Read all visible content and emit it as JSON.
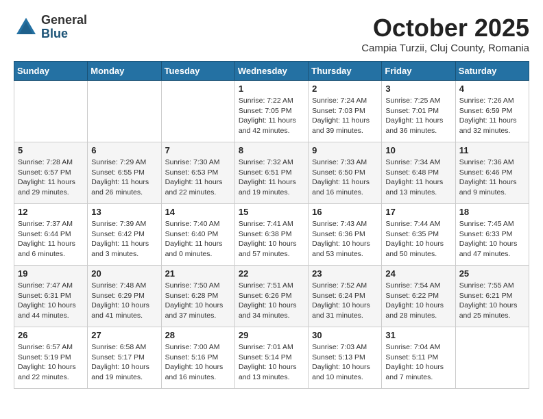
{
  "header": {
    "logo_general": "General",
    "logo_blue": "Blue",
    "month_title": "October 2025",
    "subtitle": "Campia Turzii, Cluj County, Romania"
  },
  "weekdays": [
    "Sunday",
    "Monday",
    "Tuesday",
    "Wednesday",
    "Thursday",
    "Friday",
    "Saturday"
  ],
  "weeks": [
    [
      {
        "day": "",
        "info": ""
      },
      {
        "day": "",
        "info": ""
      },
      {
        "day": "",
        "info": ""
      },
      {
        "day": "1",
        "info": "Sunrise: 7:22 AM\nSunset: 7:05 PM\nDaylight: 11 hours\nand 42 minutes."
      },
      {
        "day": "2",
        "info": "Sunrise: 7:24 AM\nSunset: 7:03 PM\nDaylight: 11 hours\nand 39 minutes."
      },
      {
        "day": "3",
        "info": "Sunrise: 7:25 AM\nSunset: 7:01 PM\nDaylight: 11 hours\nand 36 minutes."
      },
      {
        "day": "4",
        "info": "Sunrise: 7:26 AM\nSunset: 6:59 PM\nDaylight: 11 hours\nand 32 minutes."
      }
    ],
    [
      {
        "day": "5",
        "info": "Sunrise: 7:28 AM\nSunset: 6:57 PM\nDaylight: 11 hours\nand 29 minutes."
      },
      {
        "day": "6",
        "info": "Sunrise: 7:29 AM\nSunset: 6:55 PM\nDaylight: 11 hours\nand 26 minutes."
      },
      {
        "day": "7",
        "info": "Sunrise: 7:30 AM\nSunset: 6:53 PM\nDaylight: 11 hours\nand 22 minutes."
      },
      {
        "day": "8",
        "info": "Sunrise: 7:32 AM\nSunset: 6:51 PM\nDaylight: 11 hours\nand 19 minutes."
      },
      {
        "day": "9",
        "info": "Sunrise: 7:33 AM\nSunset: 6:50 PM\nDaylight: 11 hours\nand 16 minutes."
      },
      {
        "day": "10",
        "info": "Sunrise: 7:34 AM\nSunset: 6:48 PM\nDaylight: 11 hours\nand 13 minutes."
      },
      {
        "day": "11",
        "info": "Sunrise: 7:36 AM\nSunset: 6:46 PM\nDaylight: 11 hours\nand 9 minutes."
      }
    ],
    [
      {
        "day": "12",
        "info": "Sunrise: 7:37 AM\nSunset: 6:44 PM\nDaylight: 11 hours\nand 6 minutes."
      },
      {
        "day": "13",
        "info": "Sunrise: 7:39 AM\nSunset: 6:42 PM\nDaylight: 11 hours\nand 3 minutes."
      },
      {
        "day": "14",
        "info": "Sunrise: 7:40 AM\nSunset: 6:40 PM\nDaylight: 11 hours\nand 0 minutes."
      },
      {
        "day": "15",
        "info": "Sunrise: 7:41 AM\nSunset: 6:38 PM\nDaylight: 10 hours\nand 57 minutes."
      },
      {
        "day": "16",
        "info": "Sunrise: 7:43 AM\nSunset: 6:36 PM\nDaylight: 10 hours\nand 53 minutes."
      },
      {
        "day": "17",
        "info": "Sunrise: 7:44 AM\nSunset: 6:35 PM\nDaylight: 10 hours\nand 50 minutes."
      },
      {
        "day": "18",
        "info": "Sunrise: 7:45 AM\nSunset: 6:33 PM\nDaylight: 10 hours\nand 47 minutes."
      }
    ],
    [
      {
        "day": "19",
        "info": "Sunrise: 7:47 AM\nSunset: 6:31 PM\nDaylight: 10 hours\nand 44 minutes."
      },
      {
        "day": "20",
        "info": "Sunrise: 7:48 AM\nSunset: 6:29 PM\nDaylight: 10 hours\nand 41 minutes."
      },
      {
        "day": "21",
        "info": "Sunrise: 7:50 AM\nSunset: 6:28 PM\nDaylight: 10 hours\nand 37 minutes."
      },
      {
        "day": "22",
        "info": "Sunrise: 7:51 AM\nSunset: 6:26 PM\nDaylight: 10 hours\nand 34 minutes."
      },
      {
        "day": "23",
        "info": "Sunrise: 7:52 AM\nSunset: 6:24 PM\nDaylight: 10 hours\nand 31 minutes."
      },
      {
        "day": "24",
        "info": "Sunrise: 7:54 AM\nSunset: 6:22 PM\nDaylight: 10 hours\nand 28 minutes."
      },
      {
        "day": "25",
        "info": "Sunrise: 7:55 AM\nSunset: 6:21 PM\nDaylight: 10 hours\nand 25 minutes."
      }
    ],
    [
      {
        "day": "26",
        "info": "Sunrise: 6:57 AM\nSunset: 5:19 PM\nDaylight: 10 hours\nand 22 minutes."
      },
      {
        "day": "27",
        "info": "Sunrise: 6:58 AM\nSunset: 5:17 PM\nDaylight: 10 hours\nand 19 minutes."
      },
      {
        "day": "28",
        "info": "Sunrise: 7:00 AM\nSunset: 5:16 PM\nDaylight: 10 hours\nand 16 minutes."
      },
      {
        "day": "29",
        "info": "Sunrise: 7:01 AM\nSunset: 5:14 PM\nDaylight: 10 hours\nand 13 minutes."
      },
      {
        "day": "30",
        "info": "Sunrise: 7:03 AM\nSunset: 5:13 PM\nDaylight: 10 hours\nand 10 minutes."
      },
      {
        "day": "31",
        "info": "Sunrise: 7:04 AM\nSunset: 5:11 PM\nDaylight: 10 hours\nand 7 minutes."
      },
      {
        "day": "",
        "info": ""
      }
    ]
  ]
}
